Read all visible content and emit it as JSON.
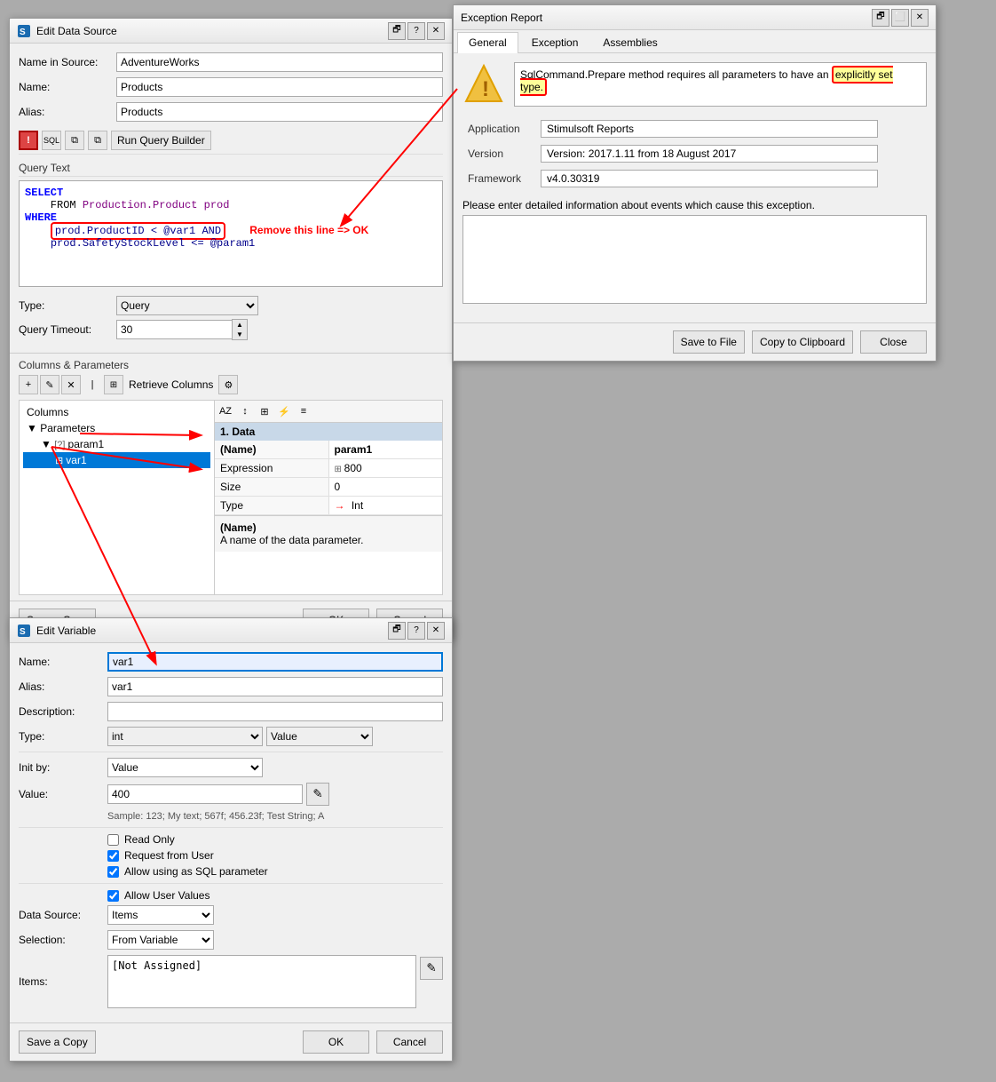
{
  "editDataSource": {
    "title": "Edit Data Source",
    "nameInSource": {
      "label": "Name in Source:",
      "value": "AdventureWorks"
    },
    "name": {
      "label": "Name:",
      "value": "Products"
    },
    "alias": {
      "label": "Alias:",
      "value": "Products"
    },
    "toolbar": {
      "runQueryBuilder": "Run Query Builder"
    },
    "queryTextLabel": "Query Text",
    "queryLines": [
      "SELECT",
      "    FROM Production.Product prod",
      "WHERE",
      "    prod.ProductID < @var1 AND",
      "    prod.SafetyStockLevel <= @param1"
    ],
    "annotation": "Remove this line => OK",
    "type": {
      "label": "Type:",
      "value": "Query"
    },
    "queryTimeout": {
      "label": "Query Timeout:",
      "value": "30"
    },
    "columnsSection": "Columns & Parameters",
    "tree": {
      "columns": "Columns",
      "parameters": "Parameters",
      "param1": "param1",
      "var1": "var1"
    },
    "props": {
      "groupTitle": "1. Data",
      "name": "(Name)",
      "nameValue": "param1",
      "expression": "Expression",
      "expressionValue": "800",
      "size": "Size",
      "sizeValue": "0",
      "type": "Type",
      "typeValue": "Int"
    },
    "propsDesc": {
      "title": "(Name)",
      "desc": "A name of the data parameter."
    },
    "footer": {
      "saveCopy": "Save a Copy",
      "ok": "OK",
      "cancel": "Cancel"
    }
  },
  "exceptionReport": {
    "title": "Exception Report",
    "tabs": [
      "General",
      "Exception",
      "Assemblies"
    ],
    "activeTab": "General",
    "message": "SqlCommand.Prepare method requires all parameters to have an explicitly set type.",
    "highlightStart": "explicitly set type.",
    "fields": {
      "application": {
        "label": "Application",
        "value": "Stimulsoft Reports"
      },
      "version": {
        "label": "Version",
        "value": "Version: 2017.1.11 from 18 August 2017"
      },
      "framework": {
        "label": "Framework",
        "value": "v4.0.30319"
      }
    },
    "detailLabel": "Please enter detailed information about events which cause this exception.",
    "buttons": {
      "saveToFile": "Save to File",
      "copyToClipboard": "Copy to Clipboard",
      "close": "Close"
    }
  },
  "editVariable": {
    "title": "Edit Variable",
    "name": {
      "label": "Name:",
      "value": "var1"
    },
    "alias": {
      "label": "Alias:",
      "value": "var1"
    },
    "description": {
      "label": "Description:",
      "value": ""
    },
    "type": {
      "label": "Type:",
      "value1": "int",
      "value2": "Value"
    },
    "initBy": {
      "label": "Init by:",
      "value": "Value"
    },
    "value": {
      "label": "Value:",
      "value": "400"
    },
    "sample": "Sample:   123; My text; 567f; 456.23f; Test String; A",
    "readOnly": "Read Only",
    "requestFromUser": "Request from User",
    "allowSqlParam": "Allow using as SQL parameter",
    "allowUserValues": "Allow User Values",
    "dataSource": {
      "label": "Data Source:",
      "value": "Items"
    },
    "selection": {
      "label": "Selection:",
      "value": "From Variable"
    },
    "items": {
      "label": "Items:",
      "value": "[Not Assigned]"
    },
    "footer": {
      "saveCopy": "Save a Copy",
      "ok": "OK",
      "cancel": "Cancel"
    }
  }
}
